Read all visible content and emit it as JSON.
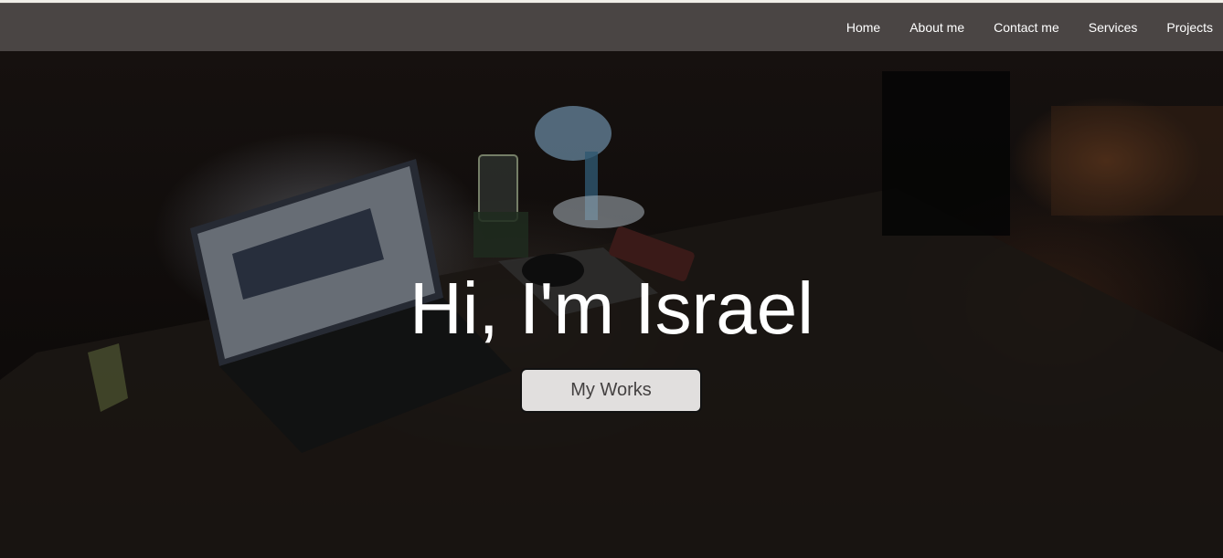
{
  "nav": {
    "links": [
      {
        "label": "Home"
      },
      {
        "label": "About me"
      },
      {
        "label": "Contact me"
      },
      {
        "label": "Services"
      },
      {
        "label": "Projects"
      }
    ]
  },
  "hero": {
    "title": "Hi, I'm Israel",
    "button_label": "My Works",
    "background_image": "dark-desk-laptop-photo"
  },
  "colors": {
    "navbar_bg": "#4a4544",
    "nav_text": "#ffffff",
    "hero_overlay": "#0b0908",
    "button_bg": "#e1dfde",
    "button_text": "#444141"
  }
}
